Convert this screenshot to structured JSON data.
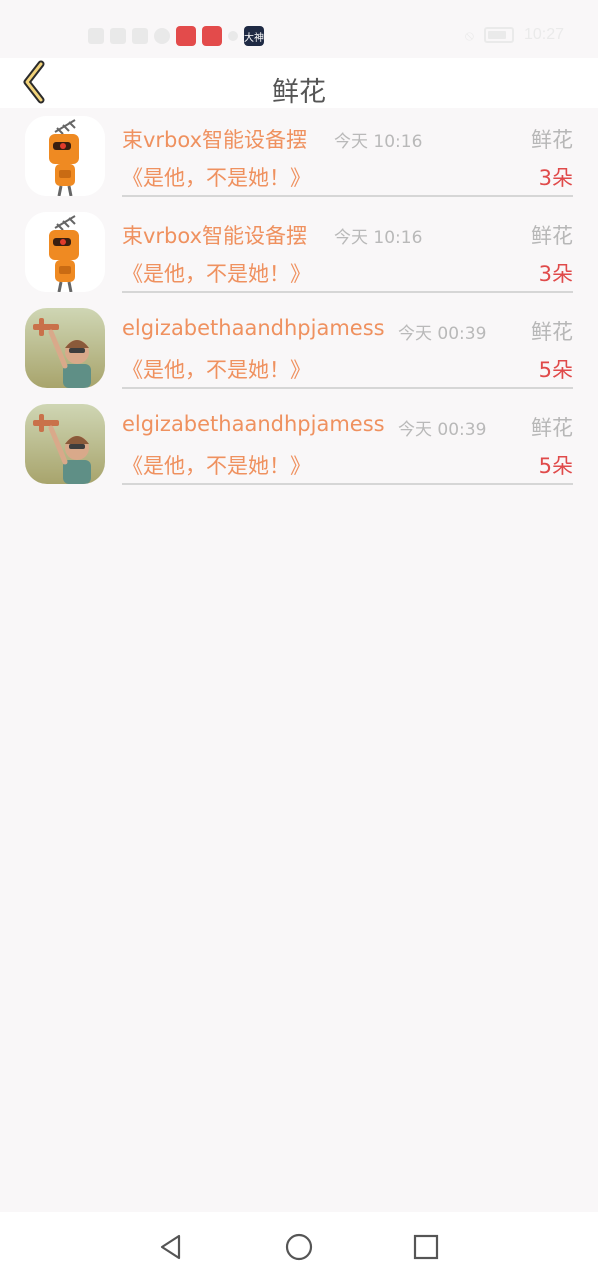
{
  "status_bar": {
    "time": "10:27",
    "app_badge": "大神"
  },
  "header": {
    "title": "鲜花",
    "back_label": "back"
  },
  "items": [
    {
      "name": "束vrbox智能设备摆",
      "time": "今天 10:16",
      "gift": "鲜花",
      "book": "《是他，不是她！》",
      "count": "3朵",
      "avatar": "robot"
    },
    {
      "name": "束vrbox智能设备摆",
      "time": "今天 10:16",
      "gift": "鲜花",
      "book": "《是他，不是她！》",
      "count": "3朵",
      "avatar": "robot"
    },
    {
      "name": "elgizabethaandhpjamess",
      "time": "今天 00:39",
      "gift": "鲜花",
      "book": "《是他，不是她！》",
      "count": "5朵",
      "avatar": "girl-plane"
    },
    {
      "name": "elgizabethaandhpjamess",
      "time": "今天 00:39",
      "gift": "鲜花",
      "book": "《是他，不是她！》",
      "count": "5朵",
      "avatar": "girl-plane"
    }
  ],
  "nav": {
    "back_icon": "triangle-back-icon",
    "home_icon": "circle-home-icon",
    "recent_icon": "square-recents-icon"
  },
  "colors": {
    "accent": "#ef915f",
    "count": "#e04a4a",
    "muted": "#b7b7b7"
  }
}
